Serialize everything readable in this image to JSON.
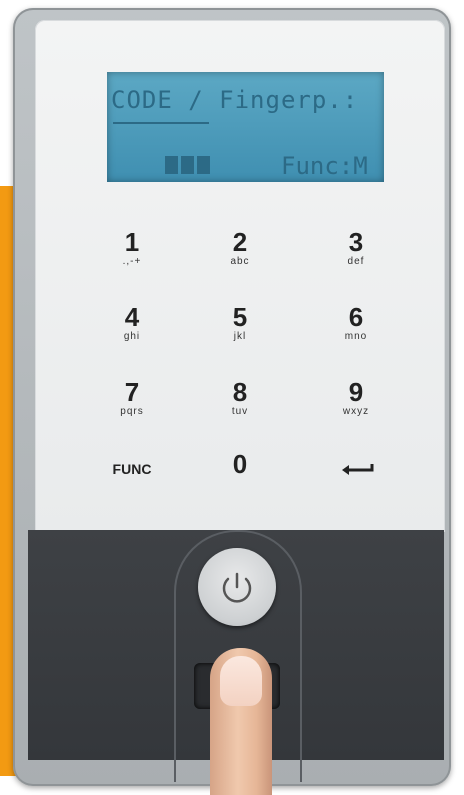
{
  "display": {
    "line1": "CODE / Fingerp.:",
    "line2_func": "Func:M",
    "battery_bars": 3
  },
  "keypad": {
    "keys": [
      {
        "num": "1",
        "sub": ".,-+"
      },
      {
        "num": "2",
        "sub": "abc"
      },
      {
        "num": "3",
        "sub": "def"
      },
      {
        "num": "4",
        "sub": "ghi"
      },
      {
        "num": "5",
        "sub": "jkl"
      },
      {
        "num": "6",
        "sub": "mno"
      },
      {
        "num": "7",
        "sub": "pqrs"
      },
      {
        "num": "8",
        "sub": "tuv"
      },
      {
        "num": "9",
        "sub": "wxyz"
      },
      {
        "func": "FUNC"
      },
      {
        "num": "0",
        "sub": ""
      },
      {
        "icon": "enter-icon"
      }
    ]
  },
  "controls": {
    "power_icon": "power-icon",
    "sensor_icon": "fingerprint-sensor"
  },
  "colors": {
    "accent": "#f39a12",
    "lcd": "#4f9fc0",
    "lcd_text": "#2c6a86",
    "panel": "#35383c"
  }
}
